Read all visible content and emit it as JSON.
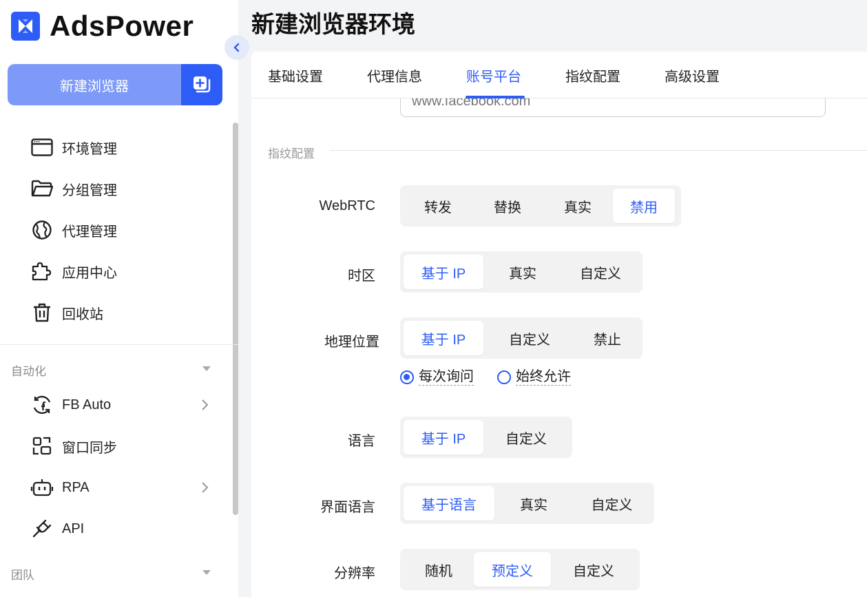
{
  "app": {
    "name": "AdsPower"
  },
  "sidebar": {
    "new_browser_label": "新建浏览器",
    "items": [
      {
        "label": "环境管理",
        "icon": "browser-window-icon"
      },
      {
        "label": "分组管理",
        "icon": "folder-icon"
      },
      {
        "label": "代理管理",
        "icon": "globe-icon"
      },
      {
        "label": "应用中心",
        "icon": "puzzle-icon"
      },
      {
        "label": "回收站",
        "icon": "trash-icon"
      }
    ],
    "automation_label": "自动化",
    "automation_items": [
      {
        "label": "FB Auto",
        "icon": "facebook-sync-icon",
        "has_children": true
      },
      {
        "label": "窗口同步",
        "icon": "window-sync-icon",
        "has_children": false
      },
      {
        "label": "RPA",
        "icon": "robot-icon",
        "has_children": true
      },
      {
        "label": "API",
        "icon": "plug-icon",
        "has_children": false
      }
    ],
    "team_label": "团队"
  },
  "page": {
    "title": "新建浏览器环境"
  },
  "tabs": [
    "基础设置",
    "代理信息",
    "账号平台",
    "指纹配置",
    "高级设置"
  ],
  "active_tab": "账号平台",
  "url_input": {
    "placeholder": "www.facebook.com"
  },
  "fingerprint_section": "指纹配置",
  "settings": {
    "webrtc": {
      "label": "WebRTC",
      "options": [
        "转发",
        "替换",
        "真实",
        "禁用"
      ],
      "selected": "禁用"
    },
    "timezone": {
      "label": "时区",
      "options": [
        "基于 IP",
        "真实",
        "自定义"
      ],
      "selected": "基于 IP"
    },
    "geolocation": {
      "label": "地理位置",
      "options": [
        "基于 IP",
        "自定义",
        "禁止"
      ],
      "selected": "基于 IP",
      "radios": [
        "每次询问",
        "始终允许"
      ],
      "radio_selected": "每次询问"
    },
    "language": {
      "label": "语言",
      "options": [
        "基于 IP",
        "自定义"
      ],
      "selected": "基于 IP"
    },
    "ui_language": {
      "label": "界面语言",
      "options": [
        "基于语言",
        "真实",
        "自定义"
      ],
      "selected": "基于语言"
    },
    "resolution": {
      "label": "分辨率",
      "options": [
        "随机",
        "预定义",
        "自定义"
      ],
      "selected": "预定义"
    }
  },
  "colors": {
    "accent": "#2e5cf6",
    "accent_light": "#7e9af8"
  }
}
